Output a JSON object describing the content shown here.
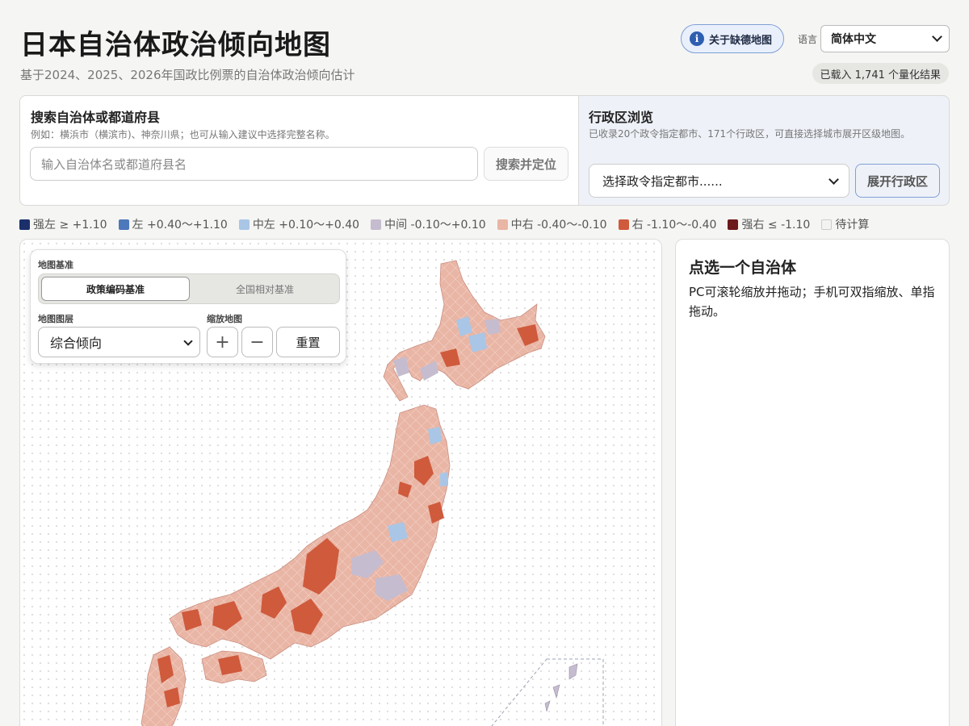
{
  "header": {
    "title": "日本自治体政治倾向地图",
    "subtitle": "基于2024、2025、2026年国政比例票的自治体政治倾向估计",
    "missing_map_button": "关于缺德地图",
    "language_label": "语言",
    "language_value": "简体中文",
    "loaded_status": "已载入 1,741 个量化结果"
  },
  "search": {
    "heading": "搜索自治体或都道府县",
    "hint": "例如：横浜市（横滨市)、神奈川県；也可从输入建议中选择完整名称。",
    "placeholder": "输入自治体名或都道府县名",
    "button": "搜索并定位"
  },
  "wards": {
    "heading": "行政区浏览",
    "hint": "已收录20个政令指定都市、171个行政区，可直接选择城市展开区级地图。",
    "select_value": "选择政令指定都市......",
    "button": "展开行政区"
  },
  "legend": [
    {
      "label": "强左 ≥ +1.10",
      "color": "#1b2f6b"
    },
    {
      "label": "左 +0.40～+1.10",
      "color": "#4d78bb"
    },
    {
      "label": "中左 +0.10～+0.40",
      "color": "#a9c6e6"
    },
    {
      "label": "中间 -0.10～+0.10",
      "color": "#c6bccf"
    },
    {
      "label": "中右 -0.40～-0.10",
      "color": "#e9b5a5"
    },
    {
      "label": "右 -1.10～-0.40",
      "color": "#cf5a3c"
    },
    {
      "label": "强右 ≤ -1.10",
      "color": "#6d1a1a"
    },
    {
      "label": "待计算",
      "color": "#f3f3f1"
    }
  ],
  "map_controls": {
    "basis_label": "地图基准",
    "basis_options": [
      "政策编码基准",
      "全国相对基准"
    ],
    "basis_selected": "政策编码基准",
    "layer_label": "地图图层",
    "layer_value": "综合倾向",
    "zoom_label": "缩放地图",
    "zoom_in": "+",
    "zoom_out": "−",
    "reset": "重置"
  },
  "info": {
    "heading": "点选一个自治体",
    "text": "PC可滚轮缩放并拖动；手机可双指缩放、单指拖动。"
  }
}
